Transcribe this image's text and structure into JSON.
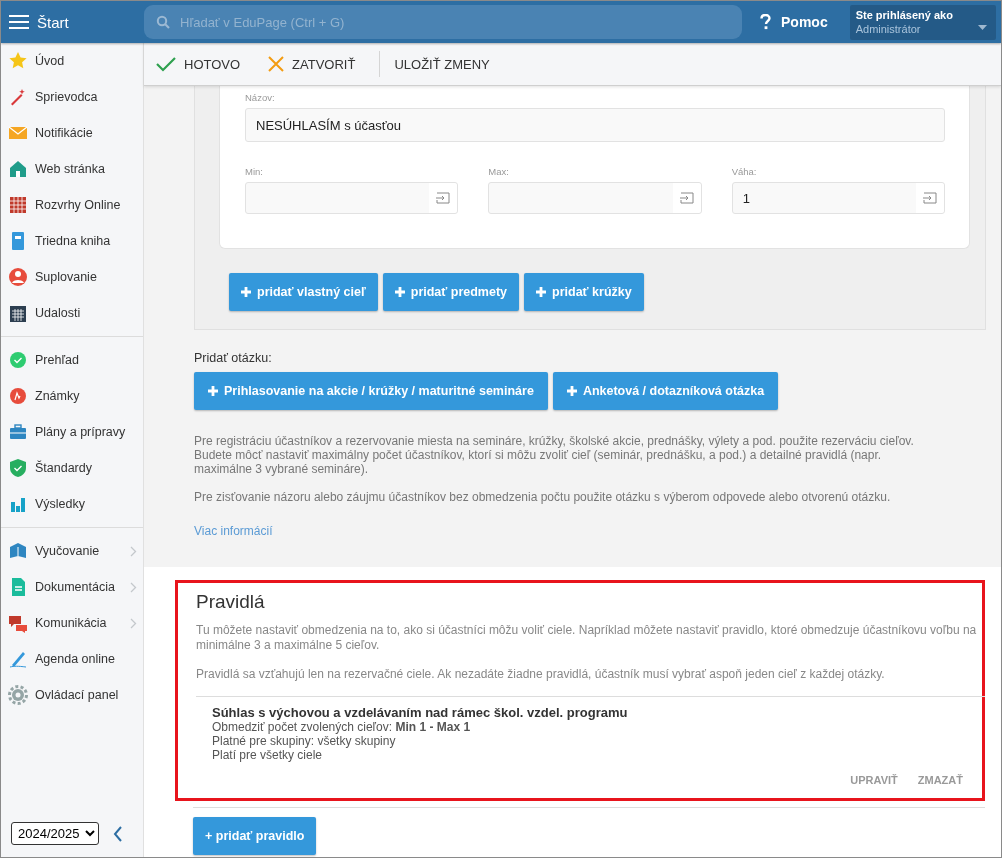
{
  "header": {
    "menu_label": "Štart",
    "search": {
      "placeholder": "Hľadať v EduPage (Ctrl + G)"
    },
    "help": "Pomoc",
    "user": {
      "caption": "Ste prihlásený ako",
      "name": "Administrátor"
    }
  },
  "sidebar": {
    "groups": [
      [
        {
          "label": "Úvod",
          "has_submenu": false
        },
        {
          "label": "Sprievodca",
          "has_submenu": false
        },
        {
          "label": "Notifikácie",
          "has_submenu": false
        },
        {
          "label": "Web stránka",
          "has_submenu": false
        },
        {
          "label": "Rozvrhy Online",
          "has_submenu": false
        },
        {
          "label": "Triedna kniha",
          "has_submenu": false
        },
        {
          "label": "Suplovanie",
          "has_submenu": false
        },
        {
          "label": "Udalosti",
          "has_submenu": false
        }
      ],
      [
        {
          "label": "Prehľad",
          "has_submenu": false
        },
        {
          "label": "Známky",
          "has_submenu": false
        },
        {
          "label": "Plány a prípravy",
          "has_submenu": false
        },
        {
          "label": "Štandardy",
          "has_submenu": false
        },
        {
          "label": "Výsledky",
          "has_submenu": false
        }
      ],
      [
        {
          "label": "Vyučovanie",
          "has_submenu": true
        },
        {
          "label": "Dokumentácia",
          "has_submenu": true
        },
        {
          "label": "Komunikácia",
          "has_submenu": true
        },
        {
          "label": "Agenda online",
          "has_submenu": false
        },
        {
          "label": "Ovládací panel",
          "has_submenu": false
        }
      ]
    ],
    "year": "2024/2025"
  },
  "toolbar": [
    {
      "label": "HOTOVO",
      "kind": "done"
    },
    {
      "label": "ZATVORIŤ",
      "kind": "close"
    },
    {
      "label": "ULOŽIŤ ZMENY",
      "kind": "save"
    }
  ],
  "goal_form": {
    "name_field": {
      "label": "Názov:",
      "value": "NESÚHLASÍM s účasťou"
    },
    "fields": [
      {
        "label": "Min:"
      },
      {
        "label": "Max:"
      },
      {
        "label": "Váha:",
        "value": "1"
      }
    ],
    "buttons": [
      "pridať vlastný cieľ",
      "pridať predmety",
      "pridať krúžky"
    ]
  },
  "add_question": {
    "label": "Pridať otázku:",
    "buttons": [
      "Prihlasovanie na akcie / krúžky / maturitné semináre",
      "Anketová / dotazníková otázka"
    ]
  },
  "info": [
    "Pre registráciu účastníkov a rezervovanie miesta na semináre, krúžky, školské akcie, prednášky, výlety a pod. použite rezerváciu cieľov. Budete môcť nastaviť maximálny počet účastníkov, ktorí si môžu zvoliť cieľ (seminár, prednášku, a pod.) a detailné pravidlá (napr. maximálne 3 vybrané semináre).",
    "Pre zisťovanie názoru alebo záujmu účastníkov bez obmedzenia počtu použite otázku s výberom odpovede alebo otvorenú otázku."
  ],
  "more_link": "Viac informácií",
  "rules": {
    "highlighted": true,
    "title": "Pravidlá",
    "info": [
      "Tu môžete nastaviť obmedzenia na to, ako si účastníci môžu voliť ciele. Napríklad môžete nastaviť pravidlo, ktoré obmedzuje účastníkovu voľbu na minimálne 3 a maximálne 5 cieľov.",
      "Pravidlá sa vzťahujú len na rezervačné ciele. Ak nezadáte žiadne pravidlá, účastník musí vybrať aspoň jeden cieľ z každej otázky."
    ],
    "items": [
      {
        "title": "Súhlas s výchovou a vzdelávaním nad rámec škol. vzdel. programu",
        "lines": [
          "Obmedziť počet zvolených cieľov: **Min 1 - Max 1**",
          "Platné pre skupiny: všetky skupiny",
          "Platí pre všetky ciele"
        ],
        "actions": [
          "UPRAVIŤ",
          "ZMAZAŤ"
        ]
      }
    ]
  },
  "add_rule_button": "+ pridať pravidlo"
}
